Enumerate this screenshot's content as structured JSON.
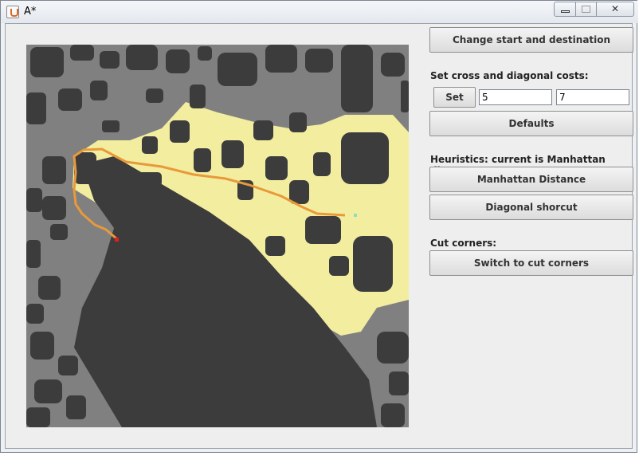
{
  "window": {
    "title": "A*"
  },
  "controls": {
    "change_button": "Change start and destination",
    "costs_label": "Set cross and diagonal costs:",
    "set_button": "Set",
    "cross_cost": "5",
    "diagonal_cost": "7",
    "defaults_button": "Defaults",
    "heuristics_label": "Heuristics: current is Manhattan distance",
    "manhattan_button": "Manhattan Distance",
    "diagonal_button": "Diagonal shorcut",
    "cut_label": "Cut corners:",
    "cut_button": "Switch to cut corners"
  },
  "map": {
    "colors": {
      "free": "#808080",
      "wall": "#3c3c3c",
      "explored": "#f3eda0",
      "path": "#e89a3a",
      "start": "#e02020",
      "goal": "#8fdcc0"
    }
  }
}
